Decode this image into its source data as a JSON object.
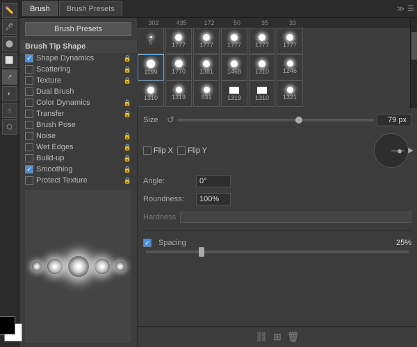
{
  "tabs": {
    "brush": "Brush",
    "brush_presets": "Brush Presets"
  },
  "toolbar": {
    "brush_presets_btn": "Brush Presets"
  },
  "options": {
    "section_label": "Brush Tip Shape",
    "items": [
      {
        "label": "Shape Dynamics",
        "checked": true,
        "locked": true
      },
      {
        "label": "Scattering",
        "checked": false,
        "locked": true
      },
      {
        "label": "Texture",
        "checked": false,
        "locked": true
      },
      {
        "label": "Dual Brush",
        "checked": false,
        "locked": false
      },
      {
        "label": "Color Dynamics",
        "checked": false,
        "locked": true
      },
      {
        "label": "Transfer",
        "checked": false,
        "locked": true
      },
      {
        "label": "Brush Pose",
        "checked": false,
        "locked": false
      },
      {
        "label": "Noise",
        "checked": false,
        "locked": true
      },
      {
        "label": "Wet Edges",
        "checked": false,
        "locked": true
      },
      {
        "label": "Build-up",
        "checked": false,
        "locked": true
      },
      {
        "label": "Smoothing",
        "checked": true,
        "locked": true
      },
      {
        "label": "Protect Texture",
        "checked": false,
        "locked": true
      }
    ]
  },
  "presets": {
    "header": [
      "302",
      "435",
      "172",
      "50",
      "35",
      "33"
    ],
    "rows": [
      [
        {
          "size": 5,
          "label": "5"
        },
        {
          "size": 12,
          "label": "1777"
        },
        {
          "size": 12,
          "label": "1777"
        },
        {
          "size": 12,
          "label": "1777"
        },
        {
          "size": 12,
          "label": "1777"
        },
        {
          "size": 12,
          "label": "1777"
        }
      ],
      [
        {
          "size": 10,
          "label": "1199"
        },
        {
          "size": 10,
          "label": "1770"
        },
        {
          "size": 9,
          "label": "1381"
        },
        {
          "size": 9,
          "label": "1468"
        },
        {
          "size": 9,
          "label": "1310"
        },
        {
          "size": 8,
          "label": "1246"
        }
      ],
      [
        {
          "size": 9,
          "label": "1310"
        },
        {
          "size": 8,
          "label": "1319"
        },
        {
          "size": 8,
          "label": "931"
        },
        {
          "size": 8,
          "label": "1319"
        },
        {
          "size": 8,
          "label": "1310"
        },
        {
          "size": 8,
          "label": "1321"
        }
      ]
    ]
  },
  "size": {
    "label": "Size",
    "value": "79 px"
  },
  "flip": {
    "flip_x": "Flip X",
    "flip_y": "Flip Y"
  },
  "angle": {
    "label": "Angle:",
    "value": "0°"
  },
  "roundness": {
    "label": "Roundness:",
    "value": "100%"
  },
  "hardness": {
    "label": "Hardness"
  },
  "spacing": {
    "label": "Spacing",
    "value": "25%",
    "checked": true
  },
  "bottom_icons": [
    "link-icon",
    "grid-icon",
    "trash-icon"
  ]
}
